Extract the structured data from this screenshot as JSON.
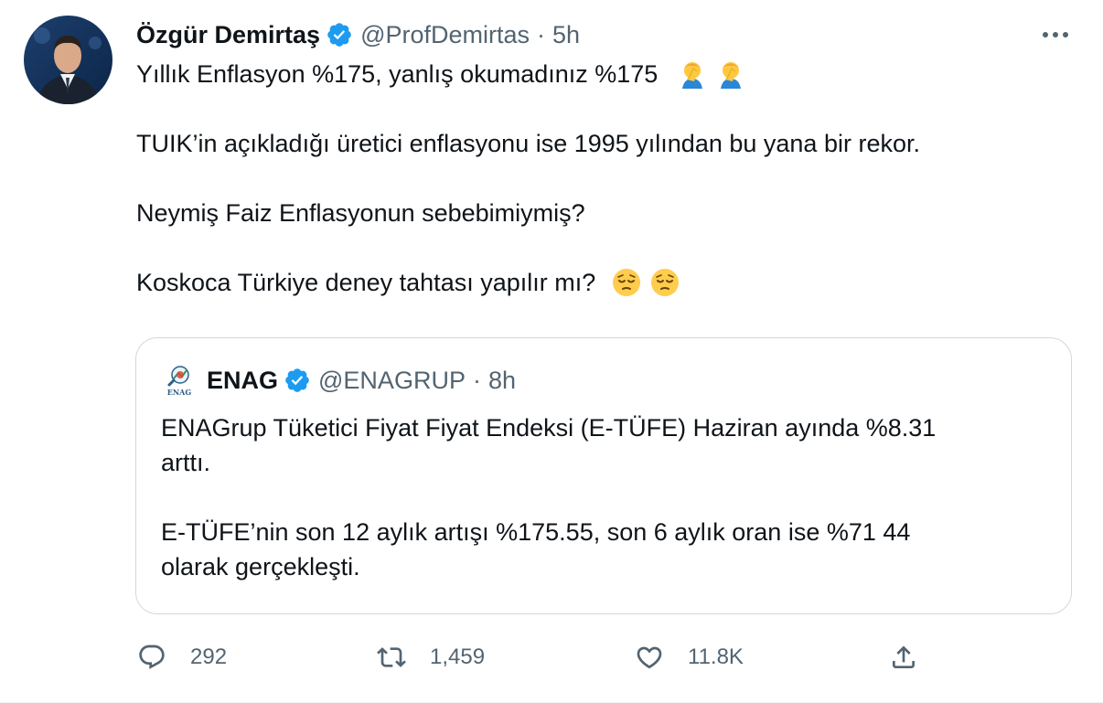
{
  "author": {
    "name": "Özgür Demirtaş",
    "handle": "@ProfDemirtas",
    "separator": "·",
    "time": "5h"
  },
  "tweet": {
    "line1": "Yıllık Enflasyon %175, yanlış okumadınız %175",
    "line1_emojis": [
      "facepalm-emoji",
      "facepalm-emoji"
    ],
    "line2": "TUIK’in açıkladığı üretici enflasyonu ise 1995 yılından bu yana bir rekor.",
    "line3": "Neymiş Faiz Enflasyonun sebebimiymiş?",
    "line4": "Koskoca Türkiye deney tahtası yapılır mı?",
    "line4_emojis": [
      "pensive-emoji",
      "pensive-emoji"
    ]
  },
  "quote": {
    "logo_text": "ENAG",
    "name": "ENAG",
    "handle": "@ENAGRUP",
    "separator": "·",
    "time": "8h",
    "p1_line1": "ENAGrup Tüketici Fiyat Fiyat Endeksi (E-TÜFE) Haziran ayında %8.31",
    "p1_line2": "arttı.",
    "p2_line1": "E-TÜFE’nin son 12 aylık artışı %175.55, son 6 aylık oran ise %71 44",
    "p2_line2": "olarak gerçekleşti."
  },
  "actions": {
    "replies": "292",
    "retweets": "1,459",
    "likes": "11.8K"
  },
  "colors": {
    "text": "#0f1419",
    "muted": "#536471",
    "verified": "#1d9bf0",
    "border": "#cfd9de"
  }
}
